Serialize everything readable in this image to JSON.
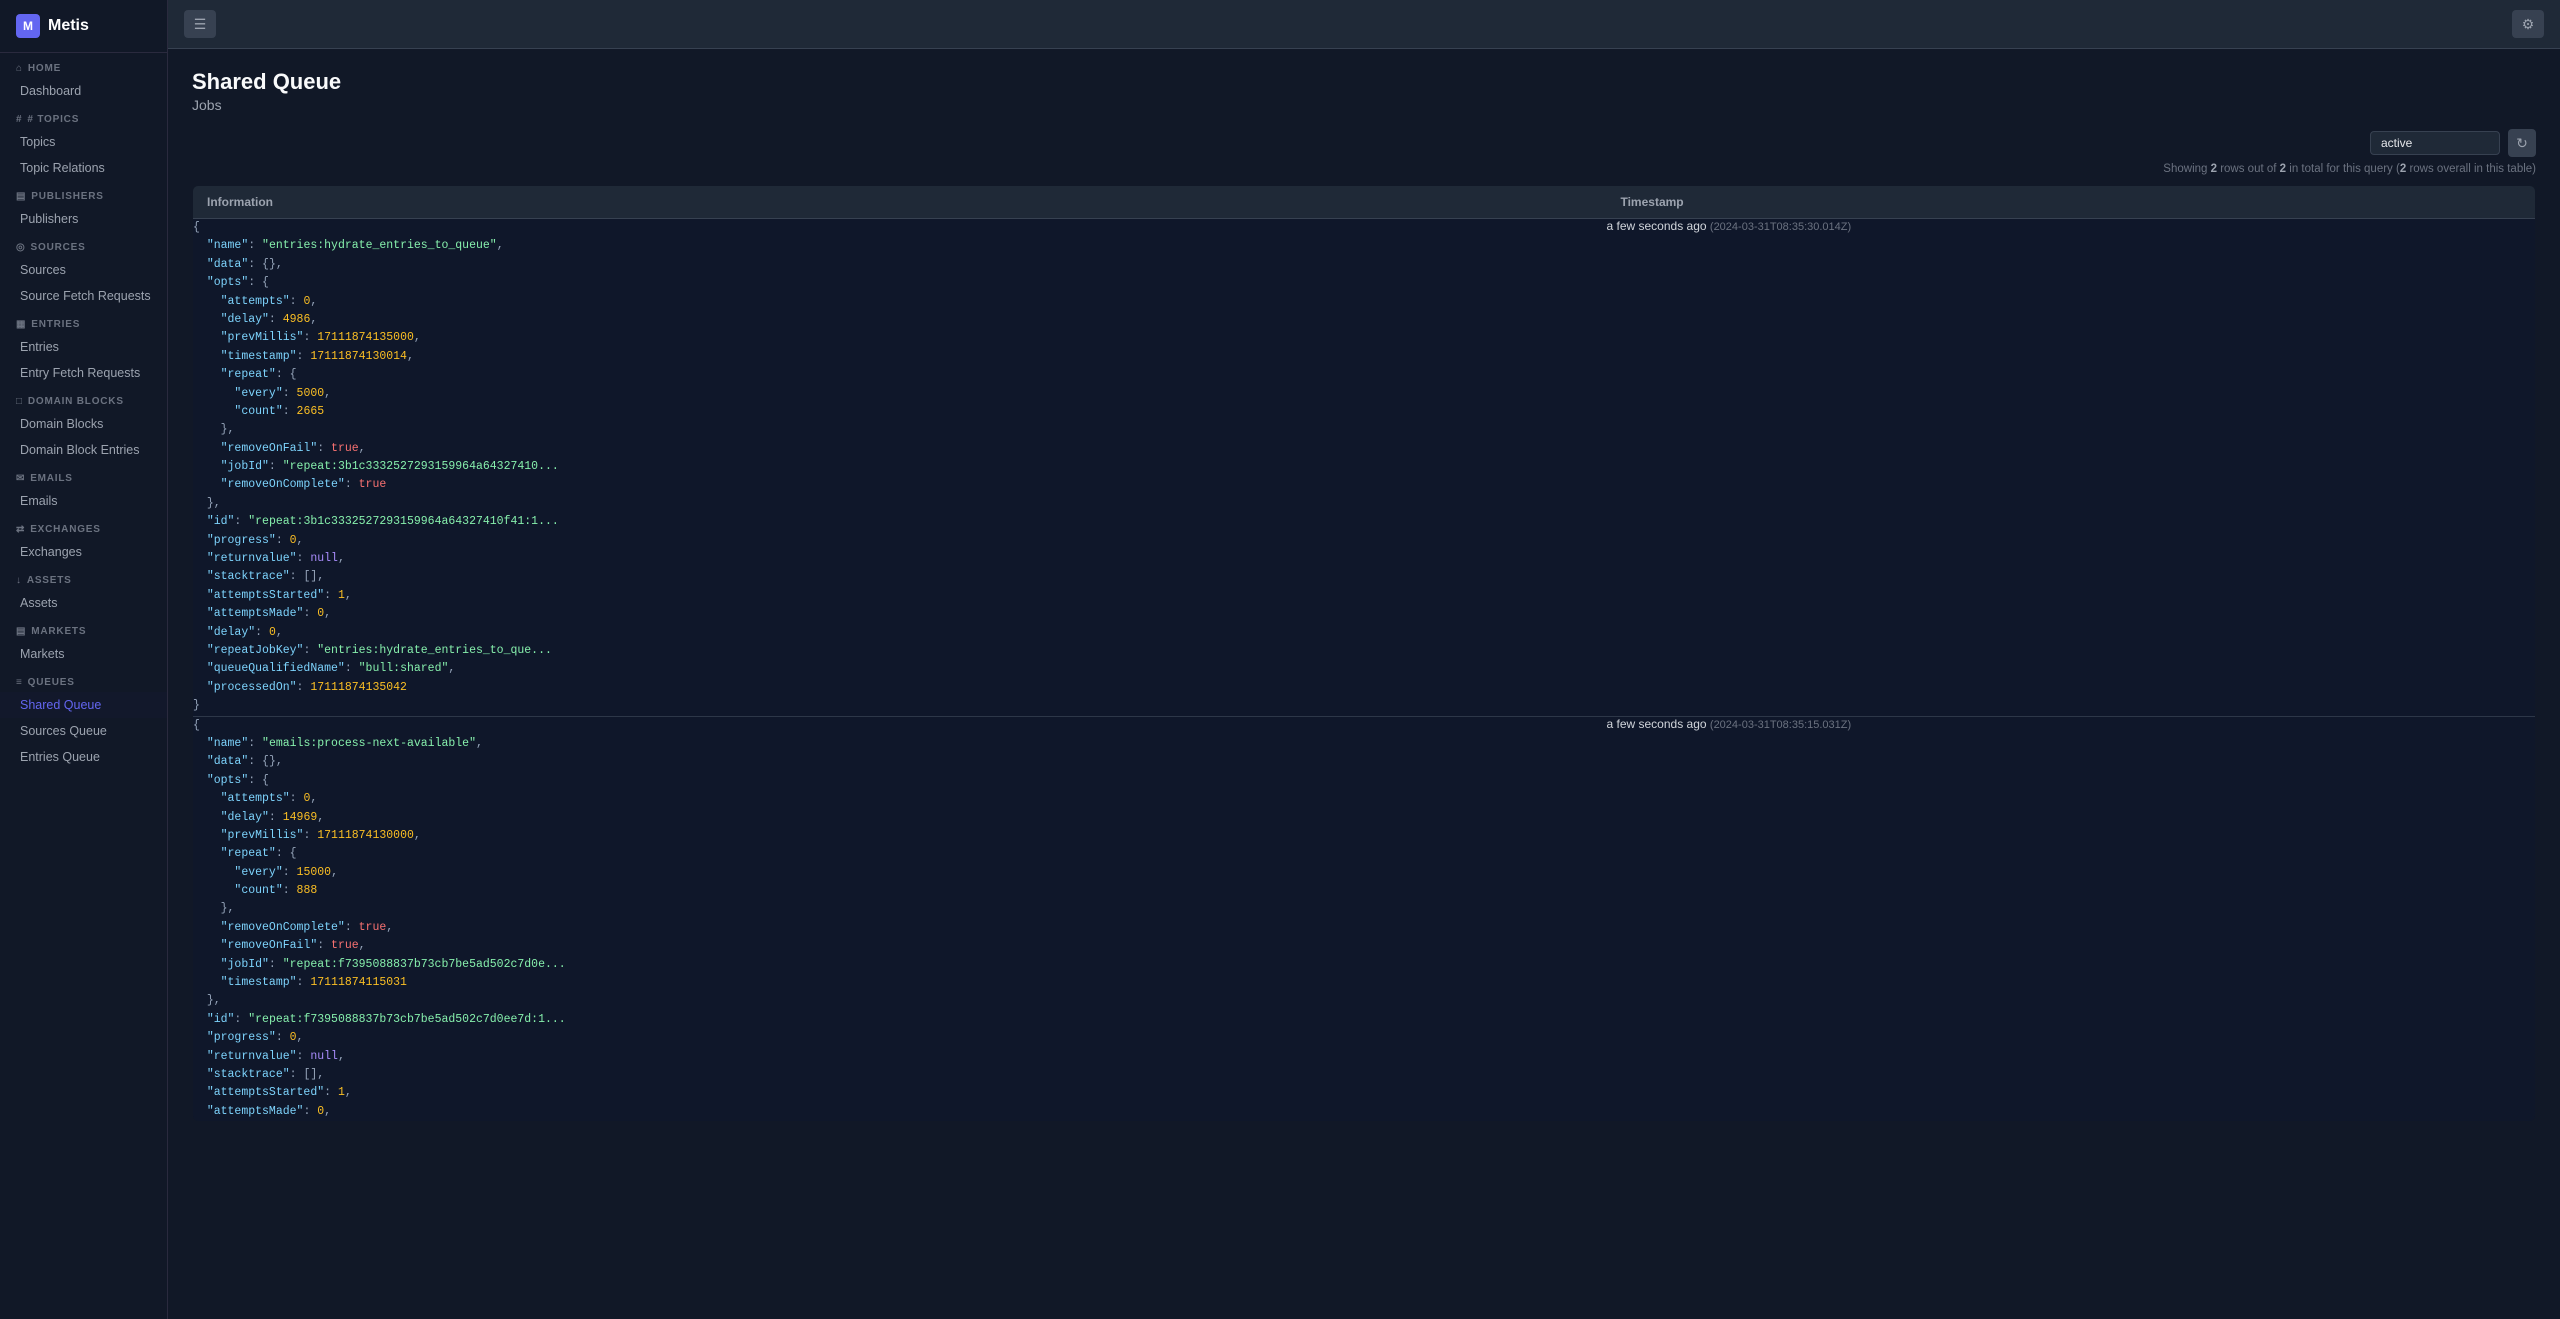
{
  "app": {
    "name": "Metis",
    "logo_icon": "M"
  },
  "sidebar": {
    "sections": [
      {
        "id": "home",
        "label": "HOME",
        "icon": "⌂",
        "items": [
          {
            "id": "dashboard",
            "label": "Dashboard",
            "active": false
          }
        ]
      },
      {
        "id": "topics",
        "label": "# TOPICS",
        "icon": "#",
        "items": [
          {
            "id": "topics",
            "label": "Topics",
            "active": false
          },
          {
            "id": "topic-relations",
            "label": "Topic Relations",
            "active": false
          }
        ]
      },
      {
        "id": "publishers",
        "label": "PUBLISHERS",
        "icon": "▤",
        "items": [
          {
            "id": "publishers",
            "label": "Publishers",
            "active": false
          }
        ]
      },
      {
        "id": "sources",
        "label": "SOURCES",
        "icon": "◎",
        "items": [
          {
            "id": "sources",
            "label": "Sources",
            "active": false
          },
          {
            "id": "source-fetch-requests",
            "label": "Source Fetch Requests",
            "active": false
          }
        ]
      },
      {
        "id": "entries",
        "label": "ENTRIES",
        "icon": "▦",
        "items": [
          {
            "id": "entries",
            "label": "Entries",
            "active": false
          },
          {
            "id": "entry-fetch-requests",
            "label": "Entry Fetch Requests",
            "active": false
          }
        ]
      },
      {
        "id": "domain-blocks",
        "label": "DOMAIN BLOCKS",
        "icon": "□",
        "items": [
          {
            "id": "domain-blocks",
            "label": "Domain Blocks",
            "active": false
          },
          {
            "id": "domain-block-entries",
            "label": "Domain Block Entries",
            "active": false
          }
        ]
      },
      {
        "id": "emails",
        "label": "EMAILS",
        "icon": "✉",
        "items": [
          {
            "id": "emails",
            "label": "Emails",
            "active": false
          }
        ]
      },
      {
        "id": "exchanges",
        "label": "EXCHANGES",
        "icon": "⇄",
        "items": [
          {
            "id": "exchanges",
            "label": "Exchanges",
            "active": false
          }
        ]
      },
      {
        "id": "assets",
        "label": "ASSETS",
        "icon": "↓",
        "items": [
          {
            "id": "assets",
            "label": "Assets",
            "active": false
          }
        ]
      },
      {
        "id": "markets",
        "label": "MARKETS",
        "icon": "▤",
        "items": [
          {
            "id": "markets",
            "label": "Markets",
            "active": false
          }
        ]
      },
      {
        "id": "queues",
        "label": "QUEUES",
        "icon": "≡",
        "items": [
          {
            "id": "shared-queue",
            "label": "Shared Queue",
            "active": true
          },
          {
            "id": "sources-queue",
            "label": "Sources Queue",
            "active": false
          },
          {
            "id": "entries-queue",
            "label": "Entries Queue",
            "active": false
          }
        ]
      }
    ]
  },
  "page": {
    "title": "Shared Queue",
    "subtitle": "Jobs",
    "filter_value": "active",
    "filter_placeholder": "active",
    "row_count_text": "Showing",
    "rows_shown": 2,
    "rows_out_of": 2,
    "rows_total": 2,
    "row_count_suffix": "rows overall in this table"
  },
  "table": {
    "columns": [
      "Information",
      "Timestamp"
    ],
    "rows": [
      {
        "info_html": "{\n  <span class='json-key'>\"name\"</span>: <span class='json-string'>\"entries:hydrate_entries_to_queue\"</span>,\n  <span class='json-key'>\"data\"</span>: <span class='json-punc'>{},</span>\n  <span class='json-key'>\"opts\"</span>: <span class='json-punc'>{</span>\n    <span class='json-key'>\"attempts\"</span>: <span class='json-number'>0</span>,\n    <span class='json-key'>\"delay\"</span>: <span class='json-number'>4986</span>,\n    <span class='json-key'>\"prevMillis\"</span>: <span class='json-number'>17111874135000</span>,\n    <span class='json-key'>\"timestamp\"</span>: <span class='json-number'>17111874130014</span>,\n    <span class='json-key'>\"repeat\"</span>: <span class='json-punc'>{</span>\n      <span class='json-key'>\"every\"</span>: <span class='json-number'>5000</span>,\n      <span class='json-key'>\"count\"</span>: <span class='json-number'>2665</span>\n    <span class='json-punc'>},</span>\n    <span class='json-key'>\"removeOnFail\"</span>: <span class='json-bool'>true</span>,\n    <span class='json-key'>\"jobId\"</span>: <span class='json-string'>\"repeat:3b1c3332527293159964a64327410...</span>\n    <span class='json-key'>\"removeOnComplete\"</span>: <span class='json-bool'>true</span>\n  <span class='json-punc'>},</span>\n  <span class='json-key'>\"id\"</span>: <span class='json-string'>\"repeat:3b1c3332527293159964a64327410f41:1...</span>\n  <span class='json-key'>\"progress\"</span>: <span class='json-number'>0</span>,\n  <span class='json-key'>\"returnvalue\"</span>: <span class='json-null'>null</span>,\n  <span class='json-key'>\"stacktrace\"</span>: <span class='json-punc'>[],</span>\n  <span class='json-key'>\"attemptsStarted\"</span>: <span class='json-number'>1</span>,\n  <span class='json-key'>\"attemptsMade\"</span>: <span class='json-number'>0</span>,\n  <span class='json-key'>\"delay\"</span>: <span class='json-number'>0</span>,\n  <span class='json-key'>\"repeatJobKey\"</span>: <span class='json-string'>\"entries:hydrate_entries_to_que...</span>\n  <span class='json-key'>\"queueQualifiedName\"</span>: <span class='json-string'>\"bull:shared\"</span>,\n  <span class='json-key'>\"processedOn\"</span>: <span class='json-number'>17111874135042</span>\n<span class='json-punc'>}</span>",
        "timestamp_relative": "a few seconds ago",
        "timestamp_absolute": "2024-03-31T08:35:30.014Z"
      },
      {
        "info_html": "<span class='json-punc'>{</span>\n  <span class='json-key'>\"name\"</span>: <span class='json-string'>\"emails:process-next-available\"</span>,\n  <span class='json-key'>\"data\"</span>: <span class='json-punc'>{},</span>\n  <span class='json-key'>\"opts\"</span>: <span class='json-punc'>{</span>\n    <span class='json-key'>\"attempts\"</span>: <span class='json-number'>0</span>,\n    <span class='json-key'>\"delay\"</span>: <span class='json-number'>14969</span>,\n    <span class='json-key'>\"prevMillis\"</span>: <span class='json-number'>17111874130000</span>,\n    <span class='json-key'>\"repeat\"</span>: <span class='json-punc'>{</span>\n      <span class='json-key'>\"every\"</span>: <span class='json-number'>15000</span>,\n      <span class='json-key'>\"count\"</span>: <span class='json-number'>888</span>\n    <span class='json-punc'>},</span>\n    <span class='json-key'>\"removeOnComplete\"</span>: <span class='json-bool'>true</span>,\n    <span class='json-key'>\"removeOnFail\"</span>: <span class='json-bool'>true</span>,\n    <span class='json-key'>\"jobId\"</span>: <span class='json-string'>\"repeat:f7395088837b73cb7be5ad502c7d0e...</span>\n    <span class='json-key'>\"timestamp\"</span>: <span class='json-number'>17111874115031</span>\n  <span class='json-punc'>},</span>\n  <span class='json-key'>\"id\"</span>: <span class='json-string'>\"repeat:f7395088837b73cb7be5ad502c7d0ee7d:1...</span>\n  <span class='json-key'>\"progress\"</span>: <span class='json-number'>0</span>,\n  <span class='json-key'>\"returnvalue\"</span>: <span class='json-null'>null</span>,\n  <span class='json-key'>\"stacktrace\"</span>: <span class='json-punc'>[],</span>\n  <span class='json-key'>\"attemptsStarted\"</span>: <span class='json-number'>1</span>,\n  <span class='json-key'>\"attemptsMade\"</span>: <span class='json-number'>0</span>,",
        "timestamp_relative": "a few seconds ago",
        "timestamp_absolute": "2024-03-31T08:35:15.031Z"
      }
    ]
  }
}
